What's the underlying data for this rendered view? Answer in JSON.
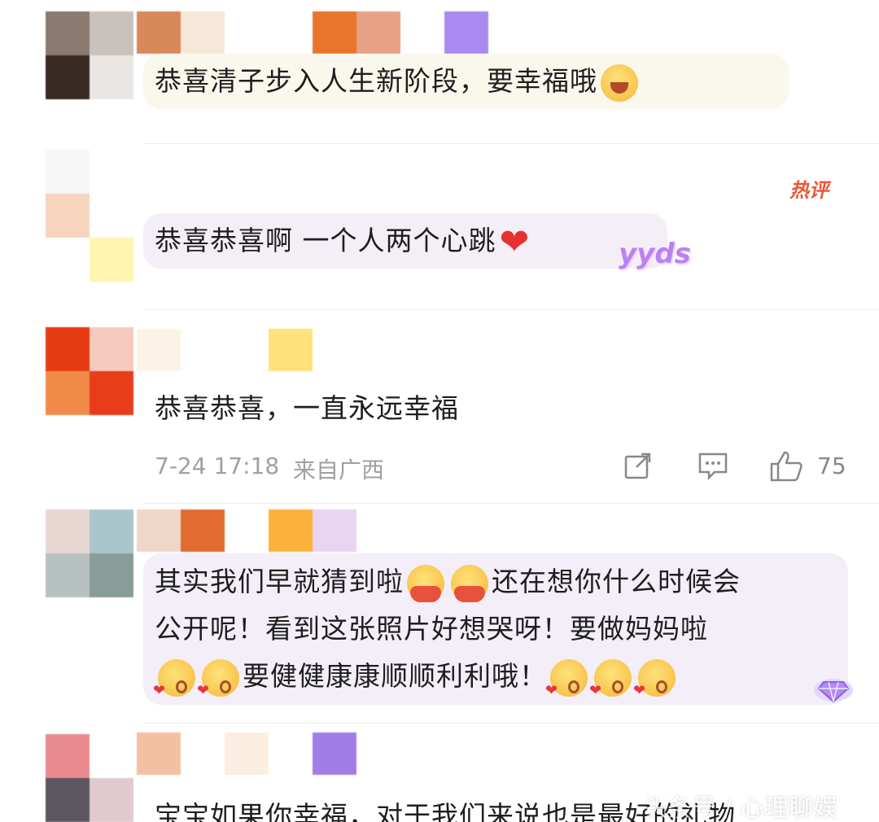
{
  "comments": [
    {
      "text": "恭喜清子步入人生新阶段，要幸福哦",
      "emoji": "laugh-cry-emoji",
      "avatar_colors": [
        "#8a7a70",
        "#c9c2bc",
        "#3a2a24",
        "#e9e6e3"
      ],
      "name_colors": [
        "#d9885a",
        "#f7e7d8",
        "#ffffff",
        "#e8762a",
        "#e8a183",
        "#ffffff",
        "#a98af0"
      ]
    },
    {
      "text": "恭喜恭喜啊 一个人两个心跳",
      "emoji": "red-heart-emoji",
      "badge_hot": "热评",
      "sticker": "yyds",
      "avatar_colors": [
        "#f7f7f7",
        "#ffffff",
        "#f6d4bd",
        "#fff5b0"
      ],
      "name_colors": []
    },
    {
      "text": "恭喜恭喜，一直永远幸福",
      "avatar_colors": [
        "#e63a12",
        "#f6c9bd",
        "#f28a4a",
        "#e83c1a"
      ],
      "name_colors": [
        "#fbf3e6",
        "#ffffff",
        "#ffffff",
        "#ffe07a"
      ],
      "time": "7-24 17:18",
      "location": "来自广西",
      "like_count": "75"
    },
    {
      "lines": [
        {
          "text_a": "其实我们早就猜到啦",
          "text_b": "还在想你什么时候会"
        },
        {
          "text_a": "公开呢！看到这张照片好想哭呀！要做妈妈啦"
        },
        {
          "text_a": "要健健康康顺顺利利哦！"
        }
      ],
      "avatar_colors": [
        "#e8d6d3",
        "#a9c6cc",
        "#b7c2c0",
        "#8a9c98"
      ],
      "name_colors": [
        "#efd7c8",
        "#e06c32",
        "#ffffff",
        "#fbb23a",
        "#e9d4f4"
      ]
    },
    {
      "text": "宝宝如果你幸福，对于我们来说也是最好的礼物",
      "avatar_colors": [
        "#e98a8e",
        "#ffffff",
        "#5c5660",
        "#e2c8cf"
      ],
      "name_colors": [
        "#f4c0a2",
        "#ffffff",
        "#fbeee0",
        "#ffffff",
        "#a37de6"
      ]
    }
  ],
  "watermark": "头条号 / 心理聊娱",
  "colors": {
    "bubble_1": "#faf7ed",
    "bubble_2": "#f4eef7",
    "bubble_4": "#f3eef8",
    "hot_tag": "#e8583c",
    "sticker": "#b982f0",
    "meta_text": "#a0a0a0"
  }
}
